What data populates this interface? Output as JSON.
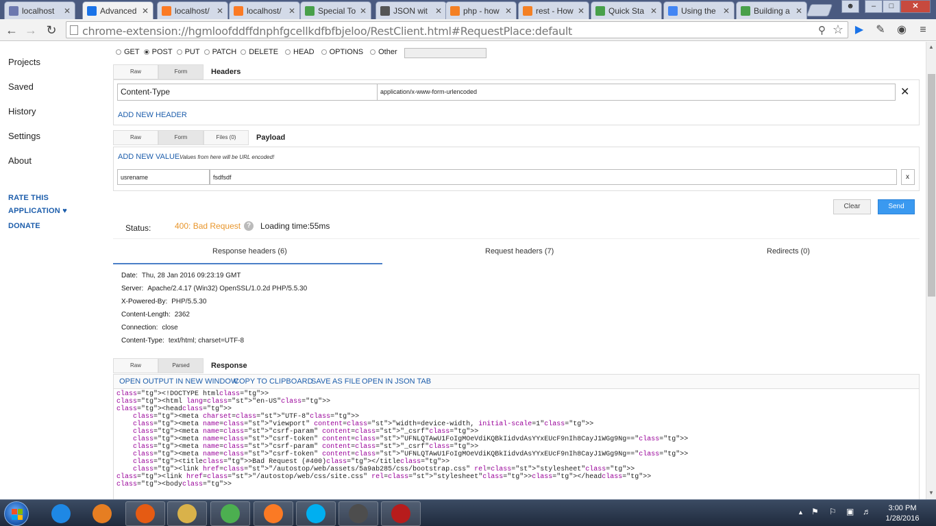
{
  "browser": {
    "tabs": [
      {
        "title": "localhost",
        "icon": "phpmyadmin-icon",
        "color": "#6c78af",
        "active": false
      },
      {
        "title": "Advanced",
        "icon": "arc-icon",
        "color": "#1a73e8",
        "active": true
      },
      {
        "title": "localhost/",
        "icon": "xampp-icon",
        "color": "#fb7a24",
        "active": false
      },
      {
        "title": "localhost/",
        "icon": "xampp-icon",
        "color": "#fb7a24",
        "active": false
      },
      {
        "title": "Special To",
        "icon": "yii-icon",
        "color": "#48a04a",
        "active": false
      },
      {
        "title": "JSON wit",
        "icon": "json-icon",
        "color": "#555555",
        "active": false
      },
      {
        "title": "php - how",
        "icon": "stackoverflow-icon",
        "color": "#f48024",
        "active": false
      },
      {
        "title": "rest - How",
        "icon": "stackoverflow-icon",
        "color": "#f48024",
        "active": false
      },
      {
        "title": "Quick Sta",
        "icon": "yii-icon",
        "color": "#48a04a",
        "active": false
      },
      {
        "title": "Using the",
        "icon": "google-icon",
        "color": "#4285f4",
        "active": false
      },
      {
        "title": "Building a",
        "icon": "yii-icon",
        "color": "#48a04a",
        "active": false
      }
    ],
    "url": "chrome-extension://hgmloofddffdnphfgcellkdfbfbjeloo/RestClient.html#RequestPlace:default"
  },
  "sidebar": {
    "items": [
      "Projects",
      "Saved",
      "History",
      "Settings",
      "About"
    ],
    "rate_line1": "RATE THIS",
    "rate_line2": "APPLICATION ♥",
    "donate": "DONATE"
  },
  "request": {
    "methods": [
      {
        "label": "GET",
        "selected": false
      },
      {
        "label": "POST",
        "selected": true
      },
      {
        "label": "PUT",
        "selected": false
      },
      {
        "label": "PATCH",
        "selected": false
      },
      {
        "label": "DELETE",
        "selected": false
      },
      {
        "label": "HEAD",
        "selected": false
      },
      {
        "label": "OPTIONS",
        "selected": false
      },
      {
        "label": "Other",
        "selected": false
      }
    ],
    "headers_tabs": {
      "raw": "Raw",
      "form": "Form",
      "label": "Headers"
    },
    "header_name": "Content-Type",
    "header_value": "application/x-www-form-urlencoded",
    "add_header": "ADD NEW HEADER",
    "payload_tabs": {
      "raw": "Raw",
      "form": "Form",
      "files": "Files (0)",
      "label": "Payload"
    },
    "add_value": "ADD NEW VALUE",
    "add_value_note": "Values from here will be URL encoded!",
    "param_name": "usrename",
    "param_value": "fsdfsdf",
    "param_remove": "x",
    "clear": "Clear",
    "send": "Send"
  },
  "response": {
    "status_label": "Status:",
    "status_value": "400: Bad Request",
    "status_color": "#e8952a",
    "loading": "Loading time:55ms",
    "tabs": [
      "Response headers (6)",
      "Request headers (7)",
      "Redirects (0)"
    ],
    "headers": [
      {
        "name": "Date:",
        "value": "Thu, 28 Jan 2016 09:23:19 GMT"
      },
      {
        "name": "Server:",
        "value": "Apache/2.4.17 (Win32) OpenSSL/1.0.2d PHP/5.5.30"
      },
      {
        "name": "X-Powered-By:",
        "value": "PHP/5.5.30"
      },
      {
        "name": "Content-Length:",
        "value": "2362"
      },
      {
        "name": "Connection:",
        "value": "close"
      },
      {
        "name": "Content-Type:",
        "value": "text/html; charset=UTF-8"
      }
    ],
    "body_tabs": {
      "raw": "Raw",
      "parsed": "Parsed",
      "label": "Response"
    },
    "actions": [
      "OPEN OUTPUT IN NEW WINDOW",
      "COPY TO CLIPBOARD",
      "SAVE AS FILE",
      "OPEN IN JSON TAB"
    ],
    "code_lines": [
      "<!DOCTYPE html>",
      "<html lang=\"en-US\">",
      "<head>",
      "    <meta charset=\"UTF-8\">",
      "    <meta name=\"viewport\" content=\"width=device-width, initial-scale=1\">",
      "    <meta name=\"csrf-param\" content=\"_csrf\">",
      "    <meta name=\"csrf-token\" content=\"UFNLQTAwU1FoIgMOeVdiKQBkIidvdAsYYxEUcF9nIh8CayJ1WGg9Ng==\">",
      "    <meta name=\"csrf-param\" content=\"_csrf\">",
      "    <meta name=\"csrf-token\" content=\"UFNLQTAwU1FoIgMOeVdiKQBkIidvdAsYYxEUcF9nIh8CayJ1WGg9Ng==\">",
      "    <title>Bad Request (#400)</title>",
      "    <link href=\"/autostop/web/assets/5a9ab285/css/bootstrap.css\" rel=\"stylesheet\">",
      "<link href=\"/autostop/web/css/site.css\" rel=\"stylesheet\"></head>",
      "<body>"
    ]
  },
  "taskbar": {
    "apps": [
      {
        "name": "ie-icon",
        "color": "#1e88e5",
        "open": false
      },
      {
        "name": "media-player-icon",
        "color": "#e67e22",
        "open": false
      },
      {
        "name": "firefox-icon",
        "color": "#e55b13",
        "open": true
      },
      {
        "name": "explorer-folder-icon",
        "color": "#d9b24a",
        "open": true
      },
      {
        "name": "chrome-icon",
        "color": "#4caf50",
        "open": true
      },
      {
        "name": "xampp-icon",
        "color": "#fb7a24",
        "open": true
      },
      {
        "name": "skype-icon",
        "color": "#00aff0",
        "open": true
      },
      {
        "name": "sublime-text-icon",
        "color": "#4d4d4d",
        "open": true
      },
      {
        "name": "filezilla-icon",
        "color": "#b71c1c",
        "open": true
      }
    ],
    "time": "3:00 PM",
    "date": "1/28/2016"
  }
}
